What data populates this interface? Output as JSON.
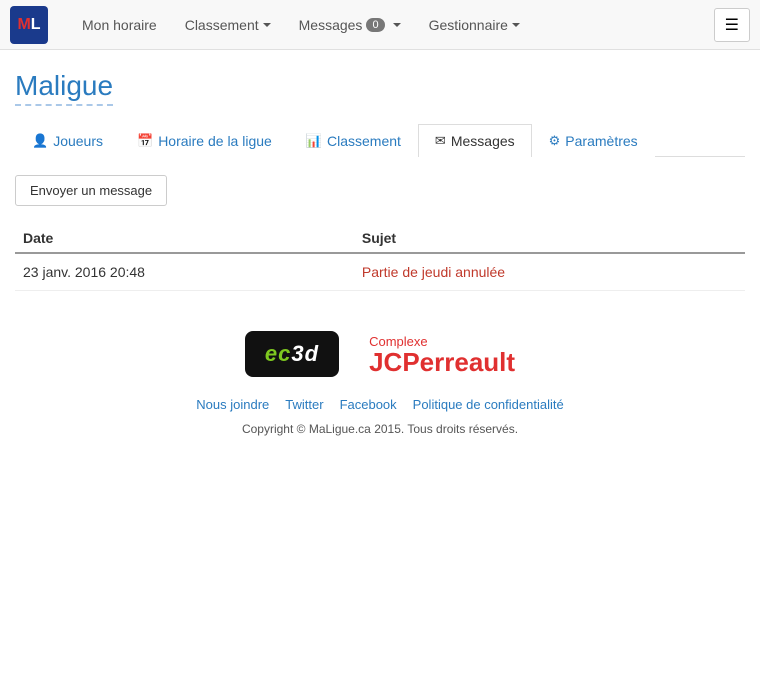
{
  "navbar": {
    "brand": "ML",
    "nav_items": [
      {
        "id": "mon-horaire",
        "label": "Mon horaire",
        "has_dropdown": false
      },
      {
        "id": "classement",
        "label": "Classement",
        "has_dropdown": true
      },
      {
        "id": "messages",
        "label": "Messages",
        "has_dropdown": true,
        "badge": "0"
      },
      {
        "id": "gestionnaire",
        "label": "Gestionnaire",
        "has_dropdown": true
      }
    ],
    "toggle_icon": "☰"
  },
  "page": {
    "title": "Maligue"
  },
  "tabs": [
    {
      "id": "joueurs",
      "icon": "👤",
      "label": "Joueurs",
      "active": false
    },
    {
      "id": "horaire",
      "icon": "📅",
      "label": "Horaire de la ligue",
      "active": false
    },
    {
      "id": "classement",
      "icon": "📊",
      "label": "Classement",
      "active": false
    },
    {
      "id": "messages",
      "icon": "✉",
      "label": "Messages",
      "active": true
    },
    {
      "id": "parametres",
      "icon": "⚙",
      "label": "Paramètres",
      "active": false
    }
  ],
  "send_button_label": "Envoyer un message",
  "table": {
    "headers": [
      "Date",
      "Sujet"
    ],
    "rows": [
      {
        "date": "23 janv. 2016 20:48",
        "subject": "Partie de jeudi annulée"
      }
    ]
  },
  "sponsors": {
    "ec3d_label": "ec3d",
    "jcp_top": "Complexe",
    "jcp_bottom": "JCPerreault"
  },
  "footer": {
    "links": [
      {
        "id": "nous-joindre",
        "label": "Nous joindre"
      },
      {
        "id": "twitter",
        "label": "Twitter"
      },
      {
        "id": "facebook",
        "label": "Facebook"
      },
      {
        "id": "politique",
        "label": "Politique de confidentialité"
      }
    ],
    "copyright": "Copyright © MaLigue.ca 2015. Tous droits réservés."
  }
}
